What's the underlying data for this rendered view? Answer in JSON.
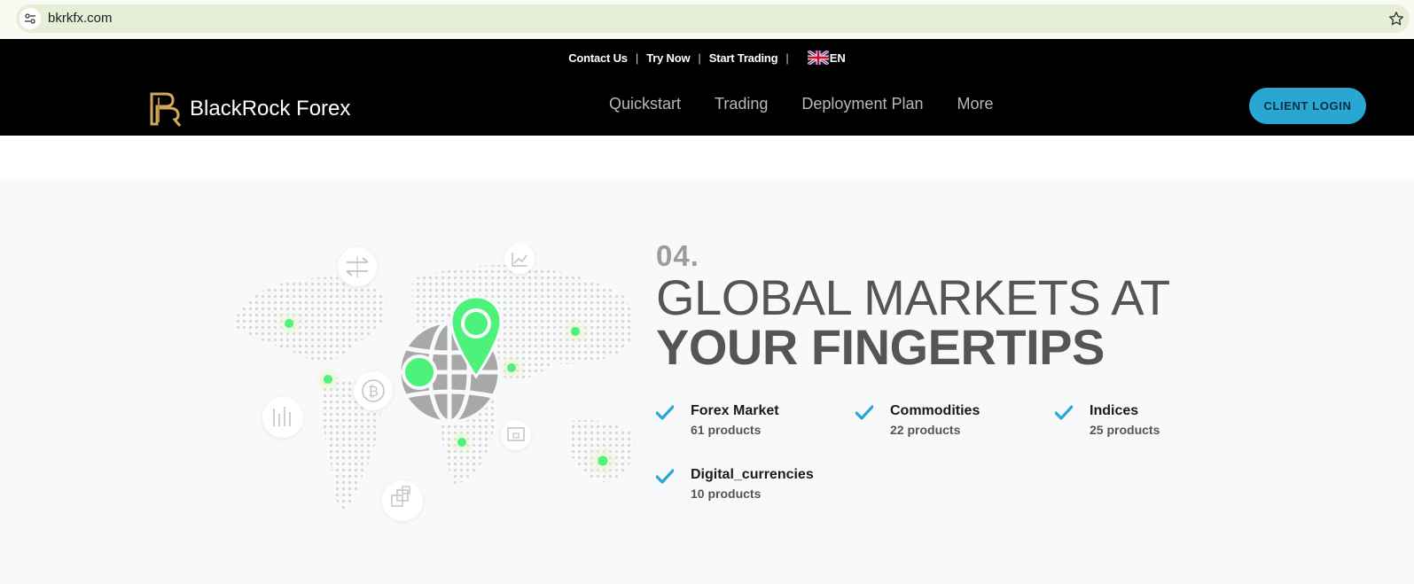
{
  "browser": {
    "url": "bkrkfx.com"
  },
  "header": {
    "topbar": {
      "links": [
        "Contact Us",
        "Try Now",
        "Start Trading"
      ],
      "language": "EN"
    },
    "brand": "BlackRock Forex",
    "nav": [
      "Quickstart",
      "Trading",
      "Deployment Plan",
      "More"
    ],
    "login_label": "CLIENT LOGIN"
  },
  "section": {
    "number": "04.",
    "headline_line1": "GLOBAL MARKETS AT",
    "headline_line2": "YOUR FINGERTIPS",
    "markets": [
      {
        "name": "Forex Market",
        "count": "61 products"
      },
      {
        "name": "Commodities",
        "count": "22 products"
      },
      {
        "name": "Indices",
        "count": "25 products"
      },
      {
        "name": "Digital_currencies",
        "count": "10 products"
      }
    ]
  },
  "colors": {
    "accent": "#2aa6d2",
    "marker_green": "#4cf27a",
    "globe_gray": "#a8a8a8",
    "heading_gray": "#555555"
  },
  "icons": [
    "site-info-icon",
    "bookmark-star-icon",
    "uk-flag-icon",
    "logo-mark-icon",
    "exchange-icon",
    "chart-icon",
    "bitcoin-icon",
    "bar-chart-icon",
    "screen-icon",
    "layers-icon",
    "location-pin-icon",
    "globe-icon",
    "check-icon"
  ]
}
